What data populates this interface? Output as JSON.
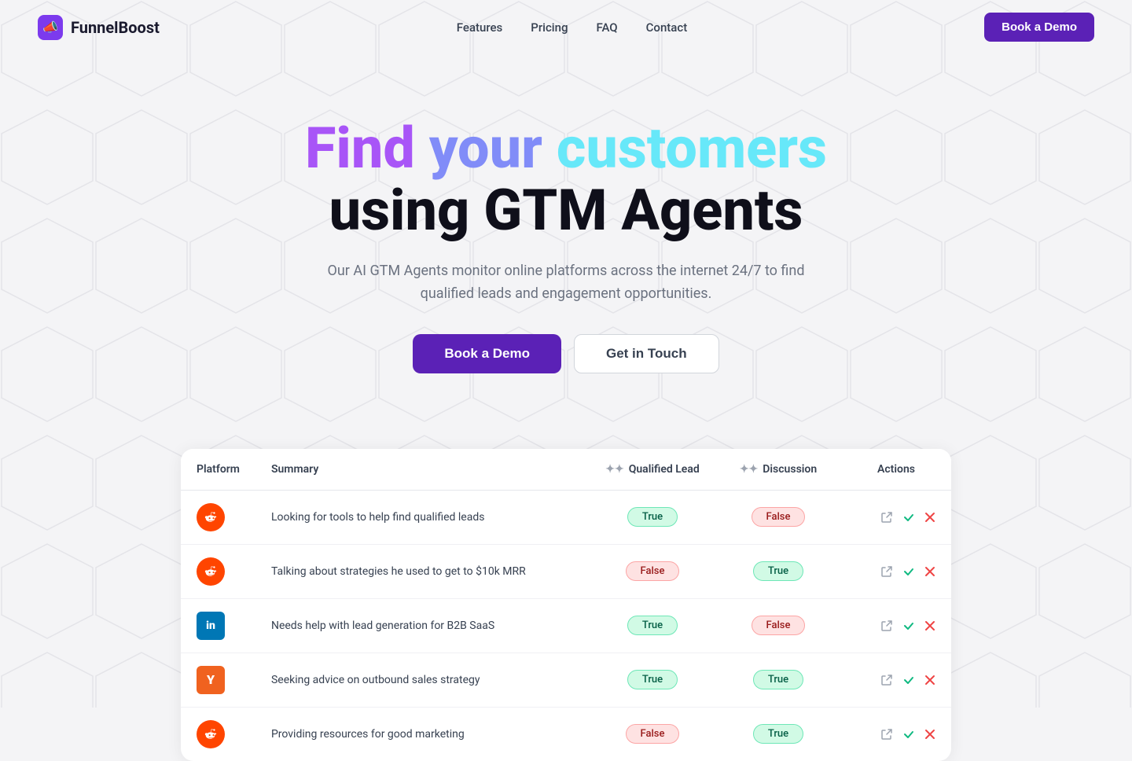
{
  "nav": {
    "logo_icon": "📣",
    "logo_text": "FunnelBoost",
    "links": [
      {
        "label": "Features",
        "href": "#"
      },
      {
        "label": "Pricing",
        "href": "#"
      },
      {
        "label": "FAQ",
        "href": "#"
      },
      {
        "label": "Contact",
        "href": "#"
      }
    ],
    "cta_label": "Book a Demo"
  },
  "hero": {
    "title_find": "Find",
    "title_your": "your",
    "title_customers": "customers",
    "title_line2": "using GTM Agents",
    "subtitle": "Our AI GTM Agents monitor online platforms across the internet 24/7 to find qualified leads and engagement opportunities.",
    "btn_demo": "Book a Demo",
    "btn_touch": "Get in Touch"
  },
  "table": {
    "headers": {
      "platform": "Platform",
      "summary": "Summary",
      "qualified_lead": "Qualified Lead",
      "discussion": "Discussion",
      "actions": "Actions"
    },
    "rows": [
      {
        "platform": "reddit",
        "summary": "Looking for tools to help find qualified leads",
        "qualified_lead": "True",
        "discussion": "False"
      },
      {
        "platform": "reddit",
        "summary": "Talking about strategies he used to get to $10k MRR",
        "qualified_lead": "False",
        "discussion": "True"
      },
      {
        "platform": "linkedin",
        "summary": "Needs help with lead generation for B2B SaaS",
        "qualified_lead": "True",
        "discussion": "False"
      },
      {
        "platform": "hackernews",
        "summary": "Seeking advice on outbound sales strategy",
        "qualified_lead": "True",
        "discussion": "True"
      },
      {
        "platform": "reddit",
        "summary": "Providing resources for good marketing",
        "qualified_lead": "False",
        "discussion": "True"
      }
    ]
  },
  "icons": {
    "sparkle": "✦",
    "external_link": "⤢",
    "check": "✓",
    "close": "✕"
  }
}
